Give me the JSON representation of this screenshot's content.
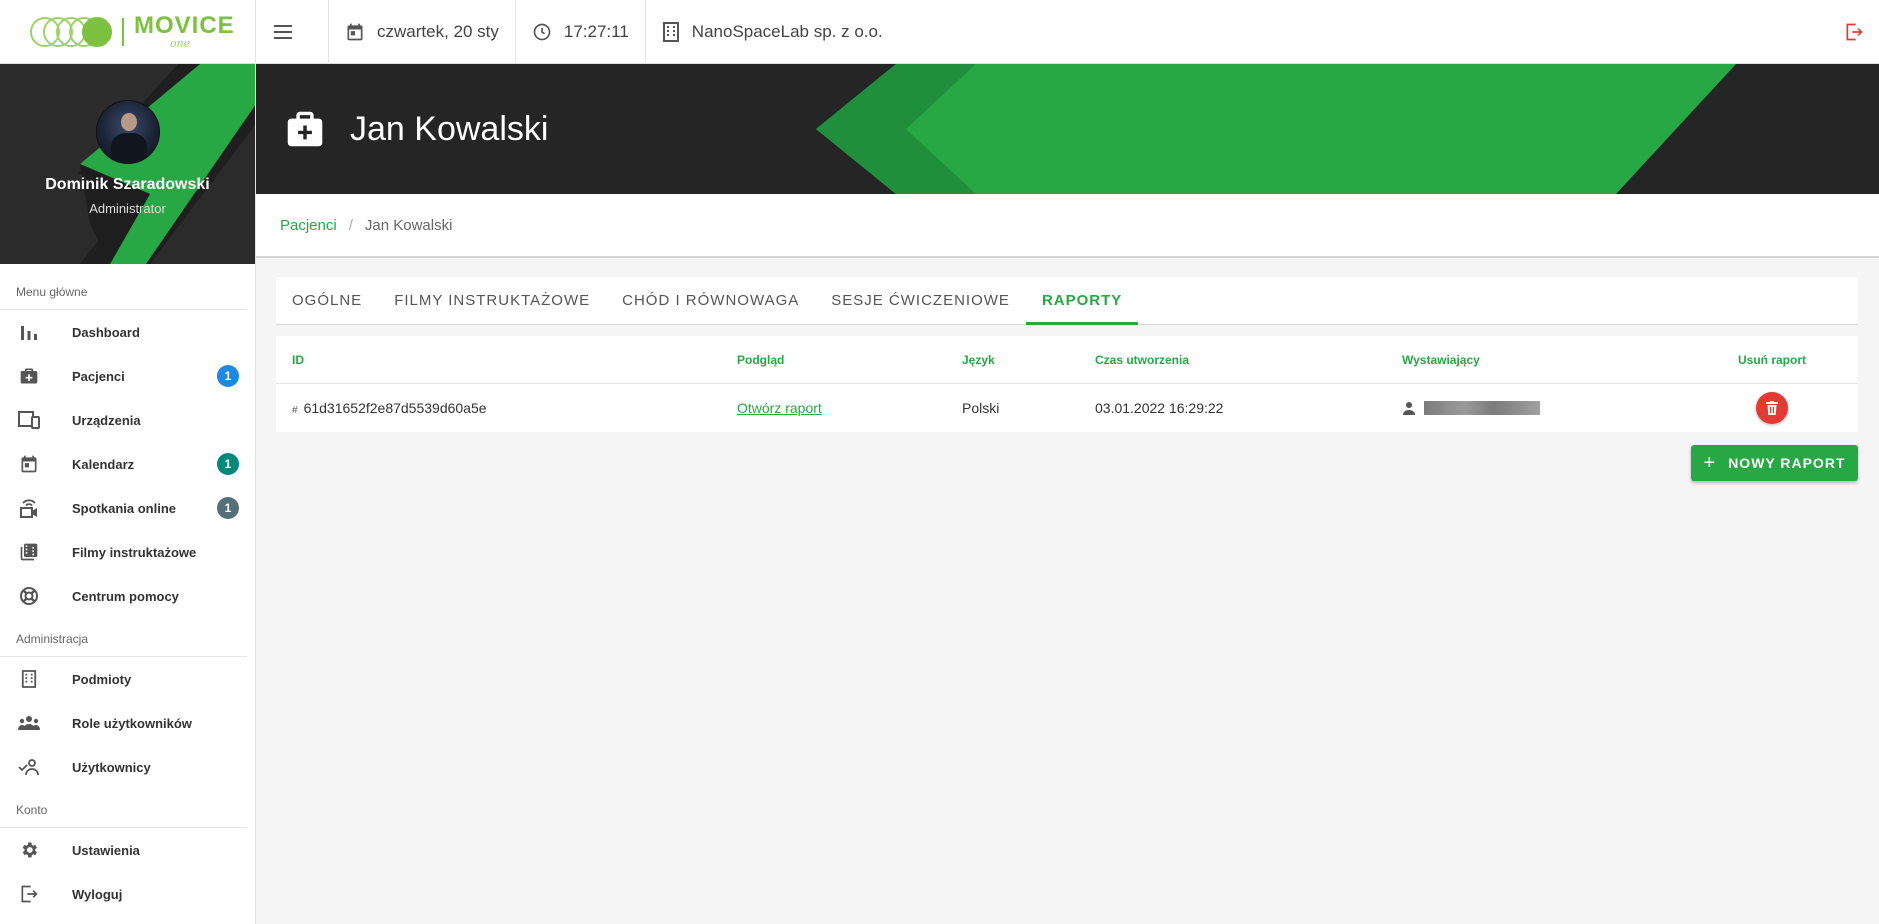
{
  "app": {
    "logo_text": "MOVICE",
    "logo_sub": "one"
  },
  "topbar": {
    "date": "czwartek, 20 sty",
    "time": "17:27:11",
    "organization": "NanoSpaceLab sp. z o.o."
  },
  "user": {
    "name": "Dominik Szaradowski",
    "role": "Administrator"
  },
  "sidebar": {
    "sections": [
      {
        "title": "Menu główne",
        "items": [
          {
            "label": "Dashboard",
            "icon": "bar-chart-icon"
          },
          {
            "label": "Pacjenci",
            "icon": "medical-bag-icon",
            "badge": "1",
            "badge_color": "#1e88e5"
          },
          {
            "label": "Urządzenia",
            "icon": "devices-icon"
          },
          {
            "label": "Kalendarz",
            "icon": "calendar-icon",
            "badge": "1",
            "badge_color": "#00897b"
          },
          {
            "label": "Spotkania online",
            "icon": "video-meeting-icon",
            "badge": "1",
            "badge_color": "#546e7a"
          },
          {
            "label": "Filmy instruktażowe",
            "icon": "video-library-icon"
          },
          {
            "label": "Centrum pomocy",
            "icon": "lifebuoy-icon"
          }
        ]
      },
      {
        "title": "Administracja",
        "items": [
          {
            "label": "Podmioty",
            "icon": "building-icon"
          },
          {
            "label": "Role użytkowników",
            "icon": "group-icon"
          },
          {
            "label": "Użytkownicy",
            "icon": "user-check-icon"
          }
        ]
      },
      {
        "title": "Konto",
        "items": [
          {
            "label": "Ustawienia",
            "icon": "gear-icon"
          },
          {
            "label": "Wyloguj",
            "icon": "logout-icon"
          }
        ]
      }
    ]
  },
  "page": {
    "title": "Jan Kowalski",
    "breadcrumb": {
      "parent": "Pacjenci",
      "current": "Jan Kowalski"
    }
  },
  "tabs": [
    {
      "label": "OGÓLNE",
      "active": false
    },
    {
      "label": "FILMY INSTRUKTAŻOWE",
      "active": false
    },
    {
      "label": "CHÓD I RÓWNOWAGA",
      "active": false
    },
    {
      "label": "SESJE ĆWICZENIOWE",
      "active": false
    },
    {
      "label": "RAPORTY",
      "active": true
    }
  ],
  "reports_table": {
    "headers": {
      "id": "ID",
      "preview": "Podgląd",
      "language": "Język",
      "created": "Czas utworzenia",
      "issuer": "Wystawiający",
      "delete": "Usuń raport"
    },
    "rows": [
      {
        "id": "61d31652f2e87d5539d60a5e",
        "preview": "Otwórz raport",
        "language": "Polski",
        "created": "03.01.2022 16:29:22"
      }
    ]
  },
  "new_report_button": "NOWY RAPORT",
  "colors": {
    "accent": "#28a745",
    "danger": "#e53935",
    "header_dark": "#252525"
  }
}
